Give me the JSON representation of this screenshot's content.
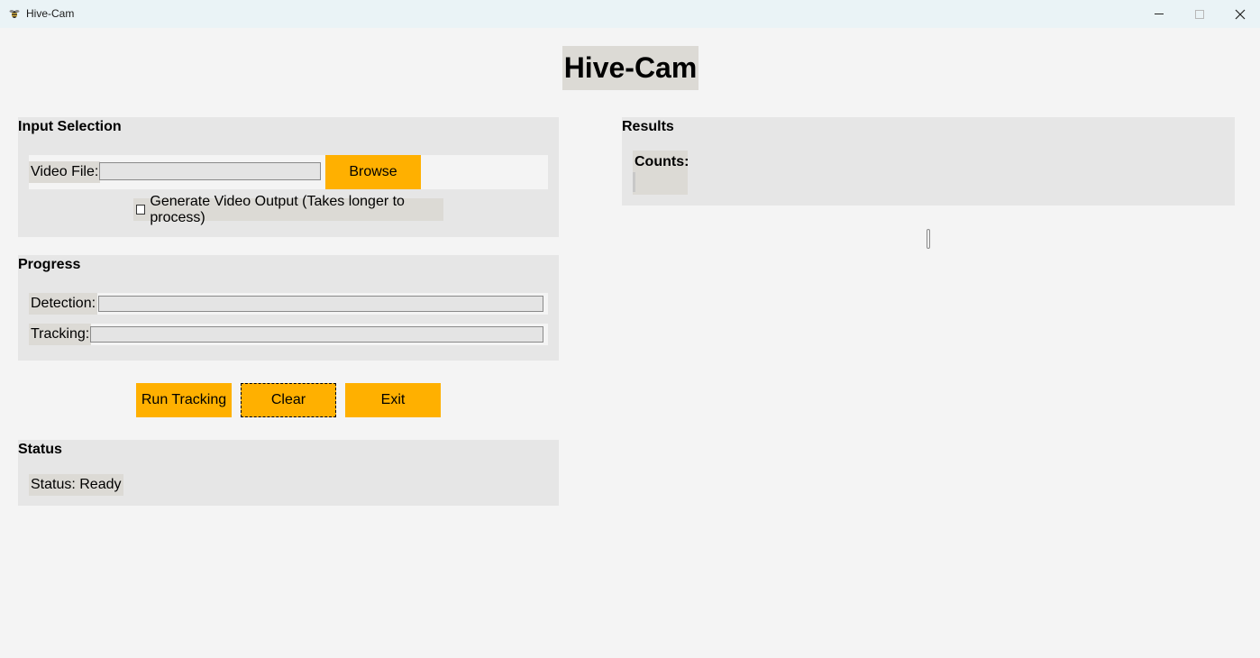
{
  "window": {
    "title": "Hive-Cam",
    "app_icon": "bee-icon",
    "controls": [
      "minimize-icon",
      "maximize-icon",
      "close-icon"
    ]
  },
  "app_heading": "Hive-Cam",
  "input_selection": {
    "title": "Input Selection",
    "video_file_label": "Video File:",
    "video_file_value": "",
    "browse_label": "Browse",
    "generate_output_label": "Generate Video Output (Takes longer to process)",
    "generate_output_checked": false
  },
  "progress": {
    "title": "Progress",
    "detection_label": "Detection:",
    "detection_value": 0,
    "tracking_label": "Tracking:",
    "tracking_value": 0
  },
  "actions": {
    "run_label": "Run Tracking",
    "clear_label": "Clear",
    "exit_label": "Exit"
  },
  "status": {
    "title": "Status",
    "text": "Status: Ready"
  },
  "results": {
    "title": "Results",
    "counts_label": "Counts:"
  },
  "colors": {
    "accent": "#ffb000",
    "background": "#f4f4f4",
    "group_background": "#e6e6e6",
    "label_background": "#dcdad5",
    "titlebar": "#eaf3f6"
  }
}
